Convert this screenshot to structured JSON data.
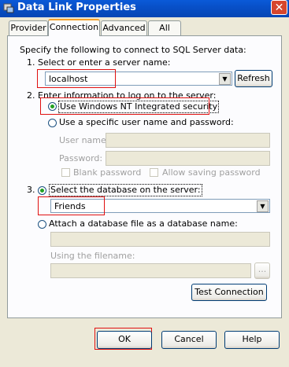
{
  "window": {
    "title": "Data Link Properties",
    "close_glyph": "✕",
    "icon": "data-link-icon"
  },
  "tabs": [
    {
      "label": "Provider"
    },
    {
      "label": "Connection"
    },
    {
      "label": "Advanced"
    },
    {
      "label": "All"
    }
  ],
  "connection": {
    "intro": "Specify the following to connect to SQL Server data:",
    "step1": "1. Select or enter a server name:",
    "server_value": "localhost",
    "refresh_label": "Refresh",
    "step2": "2. Enter information to log on to the server:",
    "use_nt_label": "Use Windows NT Integrated security",
    "use_specific_label": "Use a specific user name and password:",
    "user_name_label": "User name:",
    "password_label": "Password:",
    "blank_password_label": "Blank password",
    "allow_saving_label": "Allow saving password",
    "step3": "3.",
    "select_db_label": "Select the database on the server:",
    "database_value": "Friends",
    "attach_label": "Attach a database file as a database name:",
    "using_filename_label": "Using the filename:",
    "browse_label": "...",
    "test_connection_label": "Test Connection"
  },
  "footer": {
    "ok_label": "OK",
    "cancel_label": "Cancel",
    "help_label": "Help"
  },
  "colors": {
    "titlebar": "#0850c8",
    "dialog": "#ece9d8",
    "highlight_box": "#e01010",
    "radio_selected": "#21a121"
  }
}
